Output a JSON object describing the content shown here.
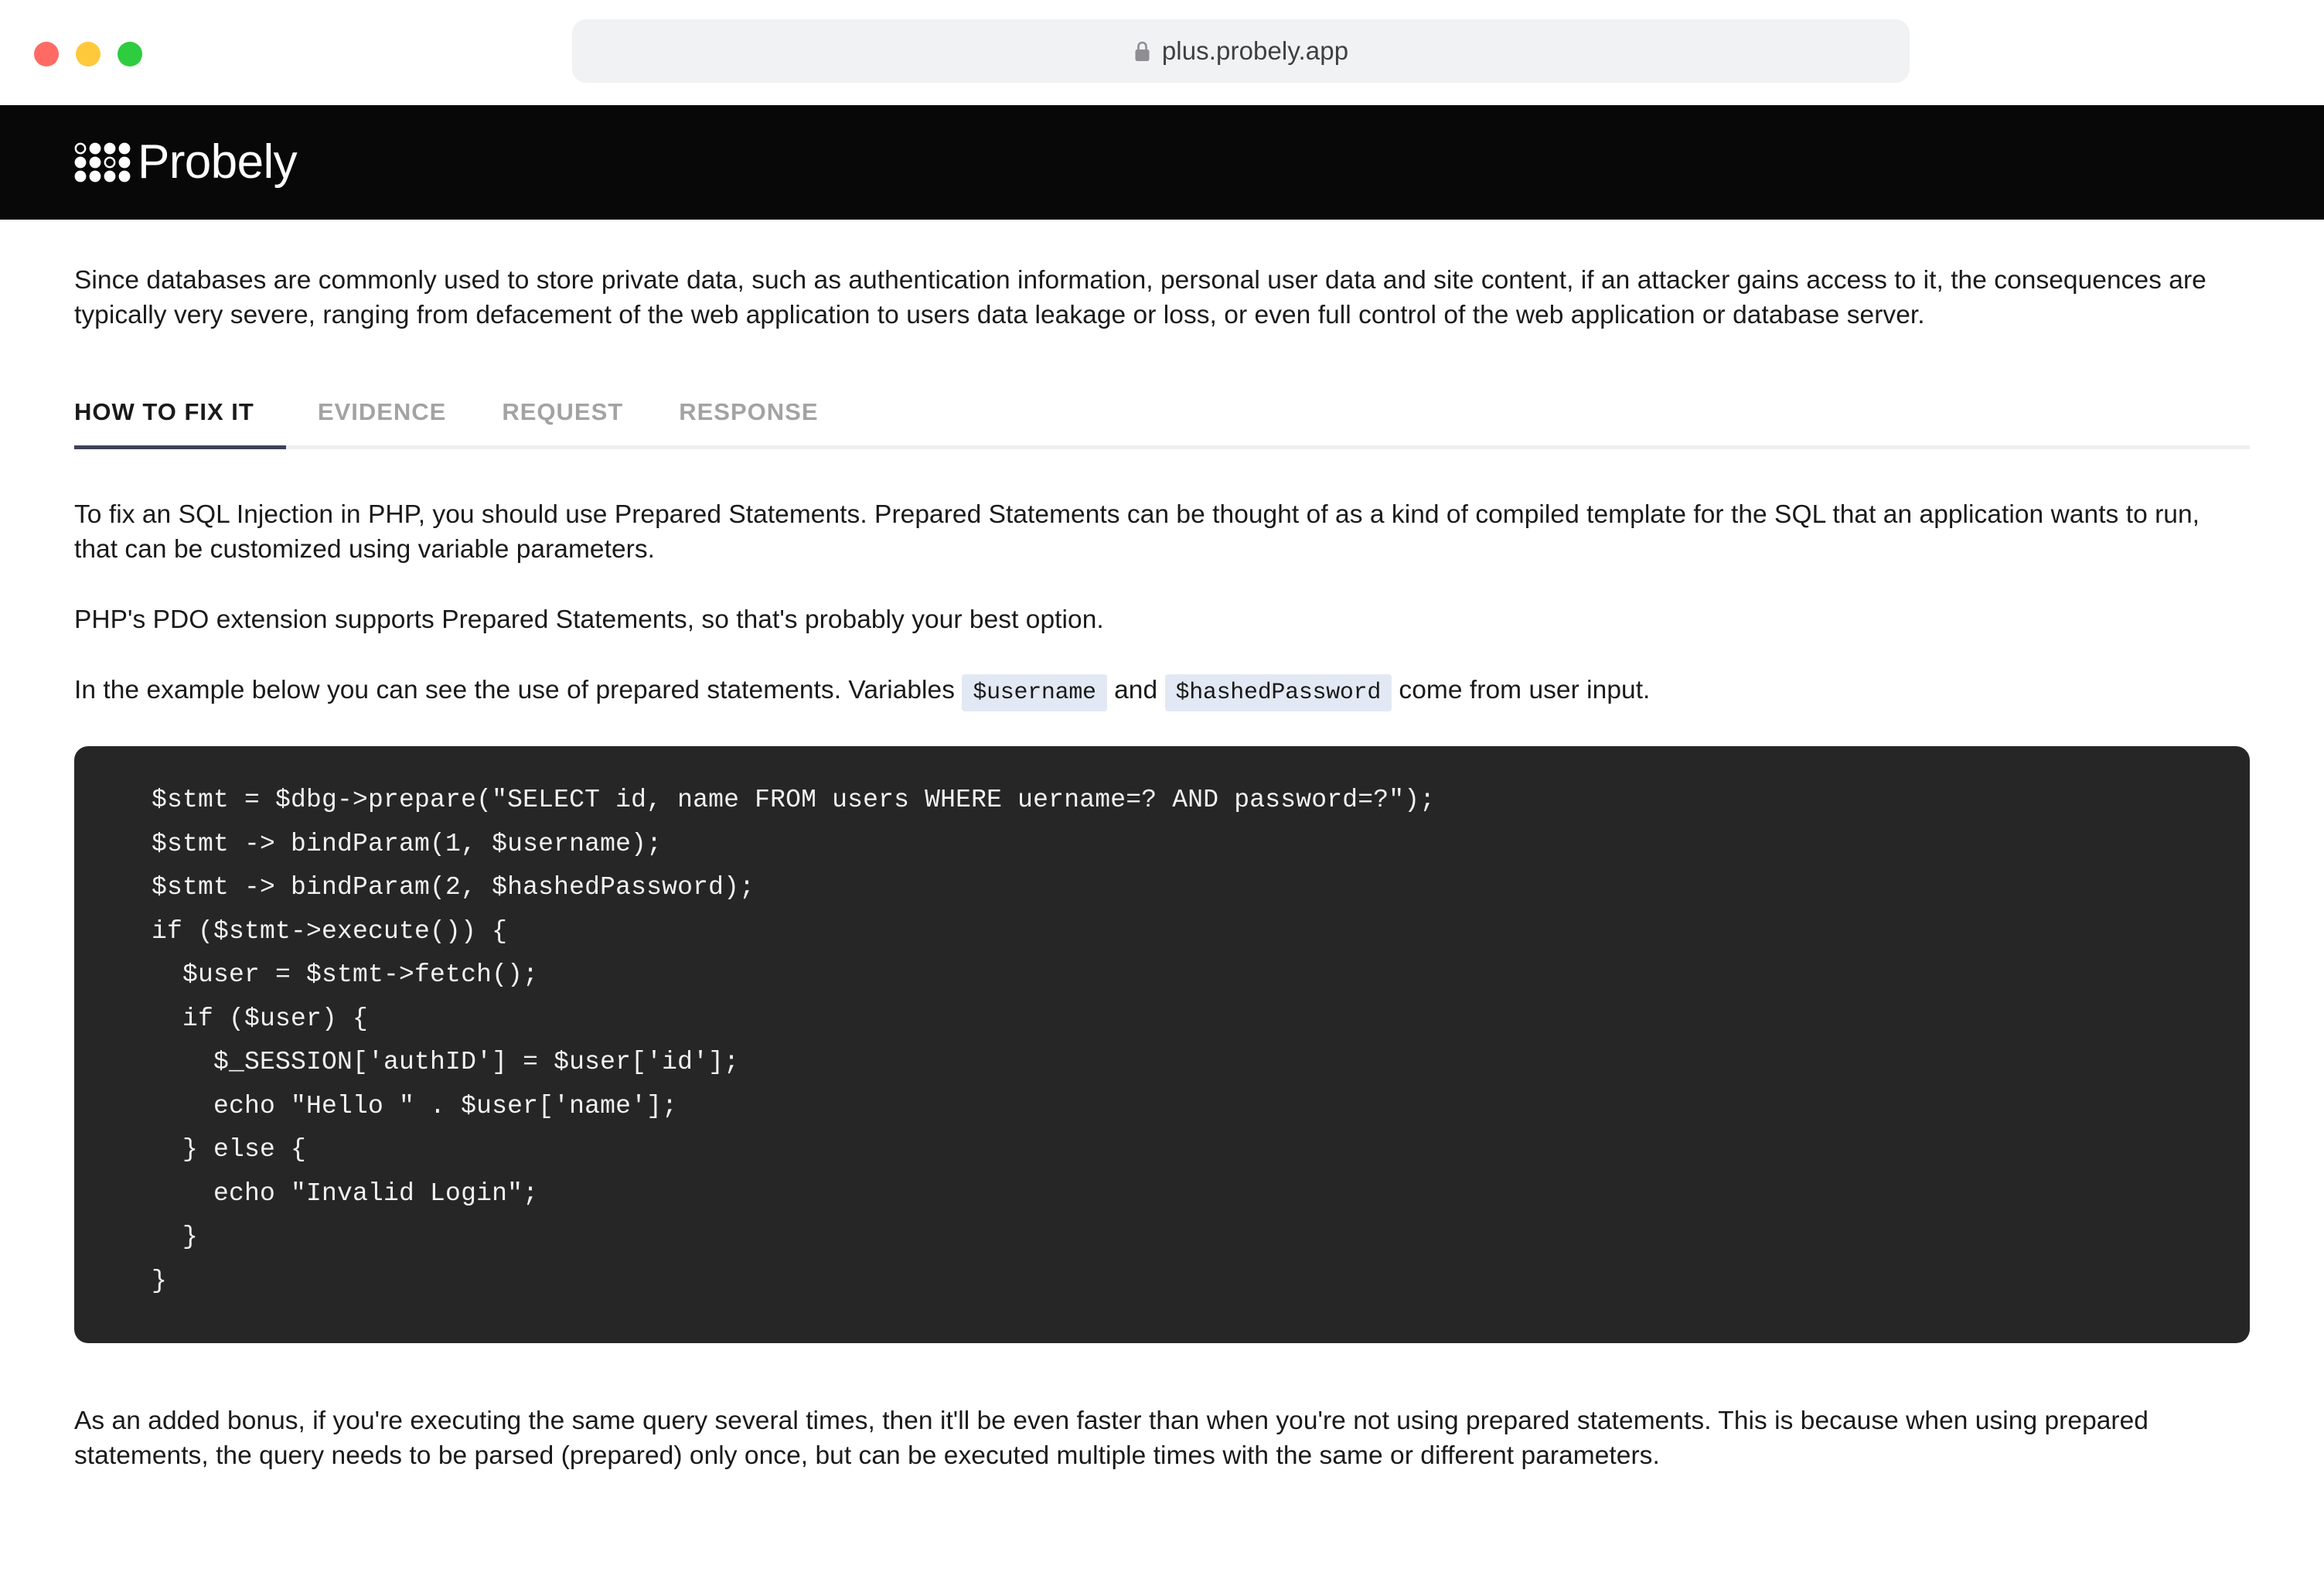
{
  "browser": {
    "url": "plus.probely.app",
    "lock_icon": "lock-icon",
    "traffic_lights": [
      {
        "name": "close",
        "color": "#ff6b64"
      },
      {
        "name": "minimize",
        "color": "#ffc93c"
      },
      {
        "name": "zoom",
        "color": "#2ecc3f"
      }
    ]
  },
  "header": {
    "brand": "Probely",
    "background": "#080808",
    "logo_icon": "probely-dots-logo-icon"
  },
  "intro": {
    "paragraph": "Since databases are commonly used to store private data, such as authentication information, personal user data and site content, if an attacker gains access to it, the consequences are typically very severe, ranging from defacement of the web application to users data leakage or loss, or even full control of the web application or database server."
  },
  "tabs": {
    "active_index": 0,
    "indicator_color": "#3b4457",
    "track_color": "#eceef1",
    "items": [
      {
        "label": "HOW TO FIX IT",
        "active": true
      },
      {
        "label": "EVIDENCE",
        "active": false
      },
      {
        "label": "REQUEST",
        "active": false
      },
      {
        "label": "RESPONSE",
        "active": false
      }
    ]
  },
  "fix": {
    "paragraph_1": "To fix an SQL Injection in PHP, you should use Prepared Statements. Prepared Statements can be thought of as a kind of compiled template for the SQL that an application wants to run, that can be customized using variable parameters.",
    "paragraph_2": "PHP's PDO extension supports Prepared Statements, so that's probably your best option.",
    "paragraph_3_part_1": "In the example below you can see the use of prepared statements. Variables",
    "inline_code_1": "$username",
    "paragraph_3_part_2": "and",
    "inline_code_2": "$hashedPassword",
    "paragraph_3_part_3": "come from user input.",
    "inline_code_bg": "#e2e9f4"
  },
  "code_block": {
    "language": "php",
    "background": "#262626",
    "text_color": "#f2f2f2",
    "content": "$stmt = $dbg->prepare(\"SELECT id, name FROM users WHERE uername=? AND password=?\");\n$stmt -> bindParam(1, $username);\n$stmt -> bindParam(2, $hashedPassword);\nif ($stmt->execute()) {\n  $user = $stmt->fetch();\n  if ($user) {\n    $_SESSION['authID'] = $user['id'];\n    echo \"Hello \" . $user['name'];\n  } else {\n    echo \"Invalid Login\";\n  }\n}"
  },
  "outro": {
    "paragraph": "As an added bonus, if you're executing the same query several times, then it'll be even faster than when you're not using prepared statements. This is because when using prepared statements, the query needs to be parsed (prepared) only once, but can be executed multiple times with the same or different parameters."
  }
}
